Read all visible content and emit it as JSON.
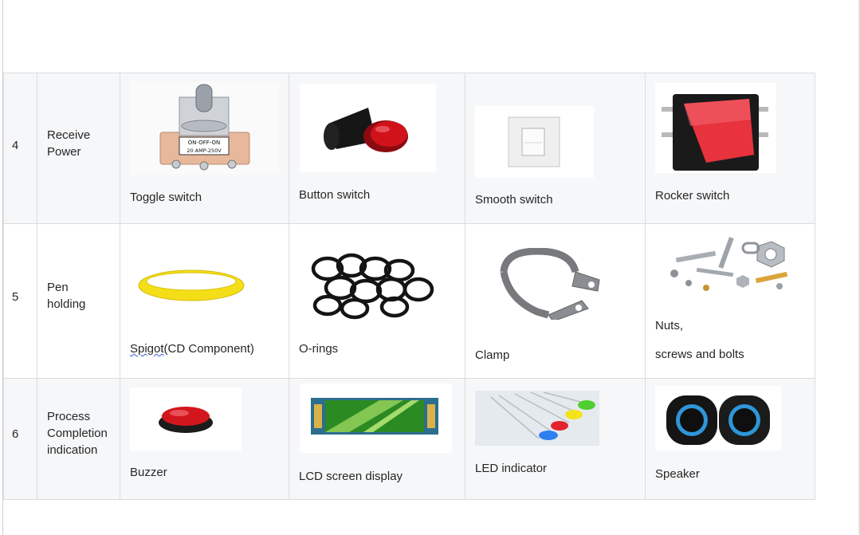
{
  "rows": [
    {
      "number": "4",
      "purpose_lines": [
        "Receive",
        "Power"
      ],
      "items": [
        {
          "caption": "Toggle switch",
          "image_text_1": "ON-OFF-ON",
          "image_text_2": "20 AMP-250V"
        },
        {
          "caption": "Button switch"
        },
        {
          "caption": "Smooth switch"
        },
        {
          "caption": "Rocker switch"
        }
      ]
    },
    {
      "number": "5",
      "purpose_lines": [
        "Pen",
        "holding"
      ],
      "items": [
        {
          "caption_underlined": "Spigot",
          "caption_rest": "(CD Component)"
        },
        {
          "caption": "O-rings"
        },
        {
          "caption": "Clamp"
        },
        {
          "caption_line1": "Nuts,",
          "caption_line2": "screws and bolts"
        }
      ]
    },
    {
      "number": "6",
      "purpose_lines": [
        "Process",
        "Completion",
        "indication"
      ],
      "items": [
        {
          "caption": "Buzzer"
        },
        {
          "caption": "LCD screen display"
        },
        {
          "caption": "LED indicator"
        },
        {
          "caption": "Speaker"
        }
      ]
    }
  ],
  "colors": {
    "row_shade": "#f6f7f9",
    "border": "#dcdcdc",
    "text": "#262626",
    "spellcheck_underline": "#3b5bdb",
    "button_red": "#d2121b",
    "rocker_red": "#e8323d",
    "ring_yellow": "#f4de18",
    "lcd_green": "#58b32a"
  },
  "icons": [
    "toggle-switch-image",
    "button-switch-image",
    "smooth-switch-image",
    "rocker-switch-image",
    "spigot-image",
    "o-rings-image",
    "clamp-image",
    "nuts-screws-bolts-image",
    "buzzer-image",
    "lcd-screen-image",
    "led-indicator-image",
    "speaker-image"
  ]
}
